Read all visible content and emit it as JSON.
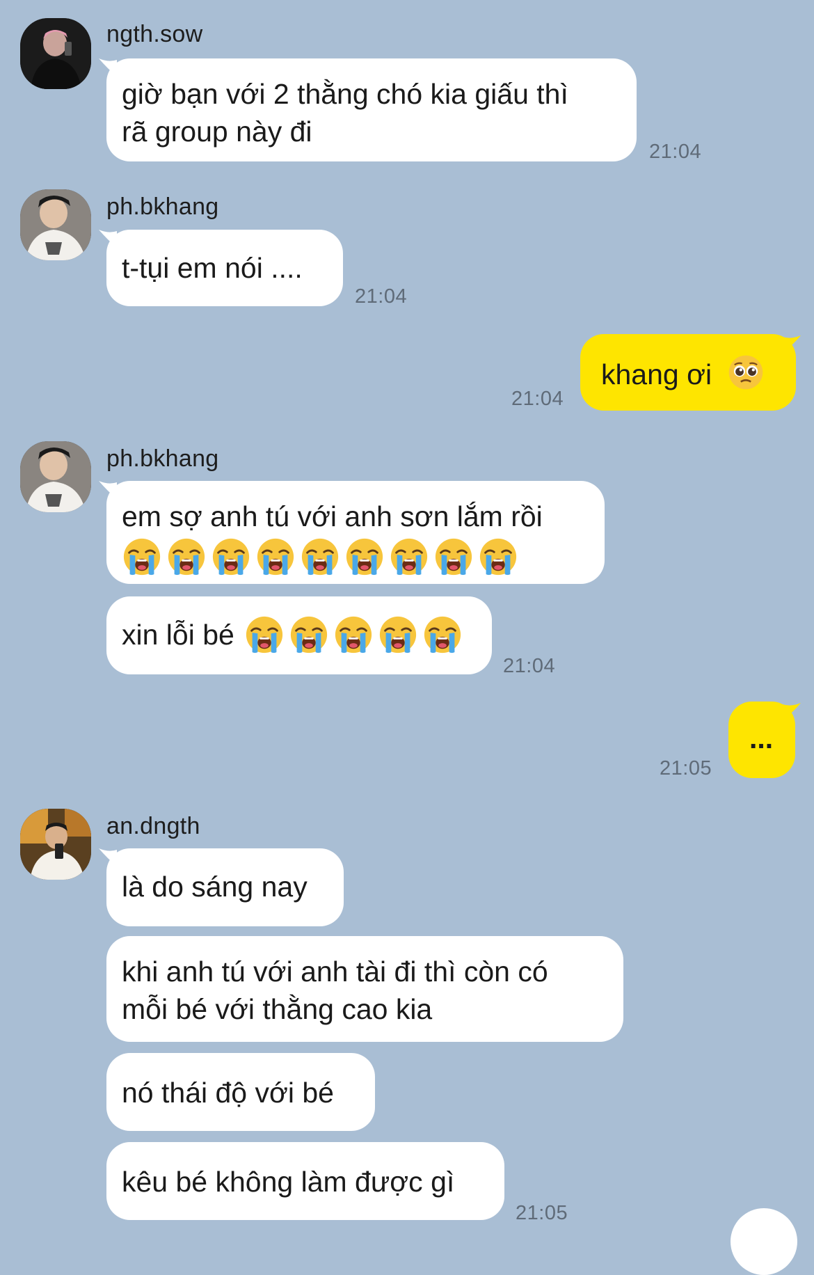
{
  "messages": {
    "m1": {
      "sender": "ngth.sow",
      "text_line1": "giờ bạn với 2 thằng chó kia giấu thì",
      "text_line2": "rã group này đi",
      "time": "21:04"
    },
    "m2": {
      "sender": "ph.bkhang",
      "text": "t-tụi em nói ....",
      "time": "21:04"
    },
    "m3": {
      "text": "khang ơi",
      "emoji": "pleading-face",
      "time": "21:04"
    },
    "m4": {
      "sender": "ph.bkhang",
      "text": "em sợ anh tú với anh sơn lắm rồi",
      "emoji": "loudly-crying-face",
      "emoji_count": 9
    },
    "m5": {
      "text": "xin lỗi bé",
      "emoji": "loudly-crying-face",
      "emoji_count": 5,
      "time": "21:04"
    },
    "m6": {
      "text": "...",
      "time": "21:05"
    },
    "m7": {
      "sender": "an.dngth",
      "text": "là do sáng nay"
    },
    "m8": {
      "text_line1": "khi anh tú với anh tài đi thì còn có",
      "text_line2": "mỗi bé với thằng cao kia"
    },
    "m9": {
      "text": "nó thái độ với bé"
    },
    "m10": {
      "text": "kêu bé không làm được gì",
      "time": "21:05"
    }
  },
  "colors": {
    "background": "#a9bed4",
    "incoming_bubble": "#ffffff",
    "outgoing_bubble": "#fee500",
    "timestamp": "#5f6b78"
  }
}
